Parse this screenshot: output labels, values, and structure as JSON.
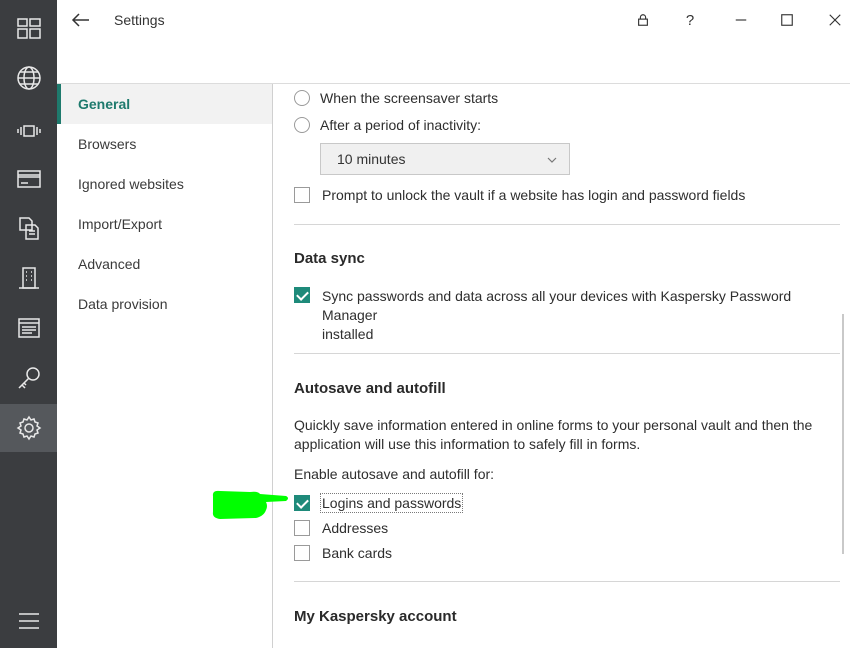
{
  "window": {
    "title": "Settings"
  },
  "rail": {
    "items": [
      {
        "name": "dashboard-icon"
      },
      {
        "name": "globe-icon"
      },
      {
        "name": "vibration-icon"
      },
      {
        "name": "credit-card-icon"
      },
      {
        "name": "documents-icon"
      },
      {
        "name": "building-icon"
      },
      {
        "name": "notes-icon"
      },
      {
        "name": "key-icon"
      },
      {
        "name": "settings-gear-icon"
      },
      {
        "name": "menu-icon"
      }
    ]
  },
  "nav": {
    "items": [
      {
        "label": "General"
      },
      {
        "label": "Browsers"
      },
      {
        "label": "Ignored websites"
      },
      {
        "label": "Import/Export"
      },
      {
        "label": "Advanced"
      },
      {
        "label": "Data provision"
      }
    ],
    "active_index": 0
  },
  "lock": {
    "screensaver_label": "When the screensaver starts",
    "inactivity_label": "After a period of inactivity:",
    "inactivity_value": "10 minutes",
    "prompt_unlock_label": "Prompt to unlock the vault if a website has login and password fields",
    "prompt_unlock_checked": false
  },
  "data_sync": {
    "heading": "Data sync",
    "sync_label_line1": "Sync passwords and data across all your devices with Kaspersky Password Manager",
    "sync_label_line2": "installed",
    "sync_checked": true
  },
  "autosave": {
    "heading": "Autosave and autofill",
    "description_line1": "Quickly save information entered in online forms to your personal vault and then the",
    "description_line2": "application will use this information to safely fill in forms.",
    "enable_label": "Enable autosave and autofill for:",
    "options": [
      {
        "label": "Logins and passwords",
        "checked": true
      },
      {
        "label": "Addresses",
        "checked": false
      },
      {
        "label": "Bank cards",
        "checked": false
      }
    ]
  },
  "account": {
    "heading": "My Kaspersky account"
  },
  "colors": {
    "accent": "#1e8a7a",
    "rail": "#3b3d40",
    "marker": "#00ff00"
  }
}
